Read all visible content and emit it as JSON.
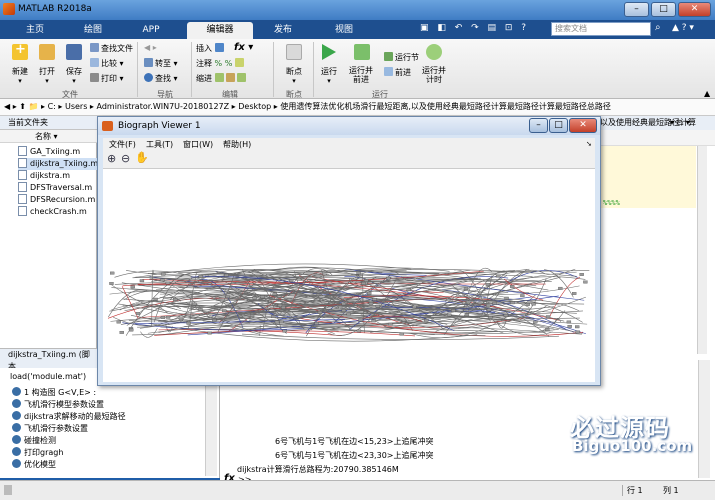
{
  "window": {
    "title": "MATLAB R2018a"
  },
  "tabs": [
    "主页",
    "绘图",
    "APP",
    "编辑器",
    "发布",
    "视图"
  ],
  "active_tab": "编辑器",
  "search": {
    "placeholder": "搜索文档"
  },
  "ribbon": {
    "file_group": {
      "label": "文件",
      "new": "新建",
      "open": "打开",
      "save": "保存",
      "find_files": "查找文件",
      "compare": "比较",
      "print": "打印"
    },
    "nav_group": {
      "label": "导航",
      "goto": "转至",
      "find": "查找"
    },
    "edit_group": {
      "label": "编辑",
      "insert": "插入",
      "comment": "注释",
      "indent": "缩进",
      "fx": "fx"
    },
    "breakpoint_group": {
      "label": "断点",
      "breakpoint": "断点"
    },
    "run_group": {
      "label": "运行",
      "run": "运行",
      "run_advance": "运行并前进",
      "run_section": "运行节",
      "advance": "前进",
      "run_time": "运行并计时"
    }
  },
  "address": {
    "parts": [
      "C:",
      "Users",
      "Administrator.WIN7U-20180127Z",
      "Desktop",
      "使用遗传算法优化机场滑行最短距离,以及使用经典最短路径计算最短路径计算最短路径总路径"
    ]
  },
  "current_folder": {
    "title": "当前文件夹",
    "column": "名称 ▾",
    "files": [
      "GA_Txiing.m",
      "dijkstra_Txiing.m",
      "dijkstra.m",
      "DFSTraversal.m",
      "DFSRecursion.m",
      "checkCrash.m"
    ]
  },
  "details": {
    "label": "dijkstra_Txiing.m (脚本"
  },
  "workspace": {
    "first_line": "load('module.mat')",
    "items": [
      "1 构造图 G<V,E> : ",
      "飞机滑行模型参数设置",
      "dijkstra求解移动的最短路径",
      "飞机滑行参数设置",
      "碰撞检测",
      "打印gragh",
      "优化模型"
    ]
  },
  "editor": {
    "tab_text": "以及使用经典最短路径计算",
    "code_marker": "%%%%"
  },
  "command_window": {
    "lines": [
      "6号飞机与1号飞机在边<15,23>上追尾冲突",
      "6号飞机与1号飞机在边<23,30>上追尾冲突",
      "dijkstra计算滑行总路程为:20790.385146M"
    ],
    "prompt": ">>",
    "fx": "fx"
  },
  "biograph": {
    "title": "Biograph Viewer 1",
    "menu": [
      "文件(F)",
      "工具(T)",
      "窗口(W)",
      "帮助(H)"
    ]
  },
  "status": {
    "row_label": "行",
    "row": "1",
    "col_label": "列",
    "col": "1"
  },
  "watermark": {
    "cn": "必过源码",
    "url": "Biguo100.com"
  }
}
